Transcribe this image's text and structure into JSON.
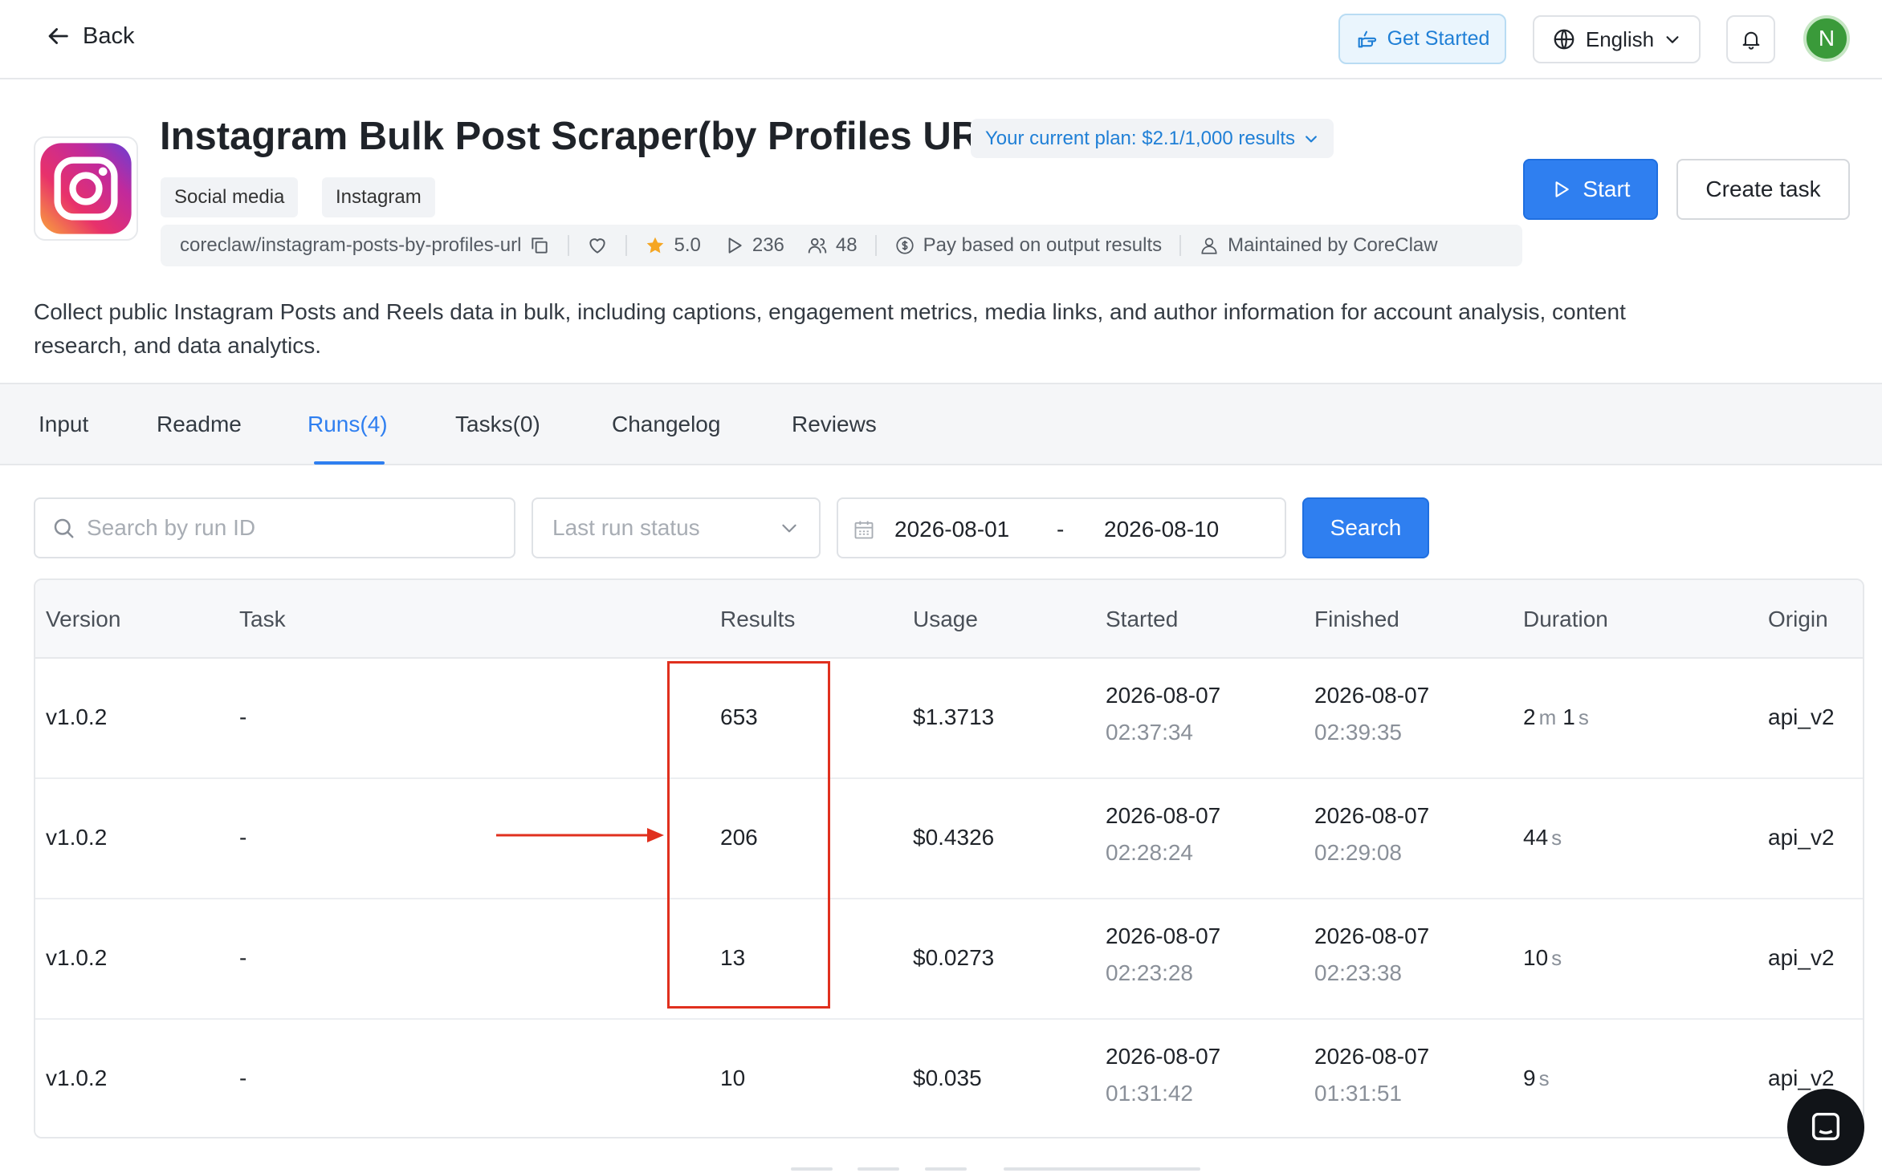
{
  "topbar": {
    "back_label": "Back",
    "get_started_label": "Get Started",
    "language_label": "English",
    "avatar_initial": "N"
  },
  "app": {
    "title": "Instagram Bulk Post Scraper(by Profiles URL)",
    "plan_label": "Your current plan: $2.1/1,000 results",
    "tags": [
      "Social media",
      "Instagram"
    ],
    "slug": "coreclaw/instagram-posts-by-profiles-url",
    "rating": "5.0",
    "runs_count": "236",
    "users_count": "48",
    "pricing": "Pay based on output results",
    "maintainer": "Maintained by CoreClaw",
    "start_label": "Start",
    "create_task_label": "Create task",
    "description": "Collect public Instagram Posts and Reels data in bulk, including captions, engagement metrics, media links, and author information for account analysis, content research, and data analytics."
  },
  "tabs": [
    "Input",
    "Readme",
    "Runs(4)",
    "Tasks(0)",
    "Changelog",
    "Reviews"
  ],
  "active_tab": "Runs(4)",
  "filters": {
    "search_placeholder": "Search by run ID",
    "status_placeholder": "Last run status",
    "date_from": "2026-08-01",
    "date_separator": "-",
    "date_to": "2026-08-10",
    "search_button": "Search"
  },
  "table": {
    "headers": [
      "Version",
      "Task",
      "Results",
      "Usage",
      "Started",
      "Finished",
      "Duration",
      "Origin"
    ],
    "rows": [
      {
        "version": "v1.0.2",
        "task": "-",
        "results": "653",
        "usage": "$1.3713",
        "started_date": "2026-08-07",
        "started_time": "02:37:34",
        "finished_date": "2026-08-07",
        "finished_time": "02:39:35",
        "duration_parts": [
          [
            "2",
            "m"
          ],
          [
            "1",
            "s"
          ]
        ],
        "origin": "api_v2"
      },
      {
        "version": "v1.0.2",
        "task": "-",
        "results": "206",
        "usage": "$0.4326",
        "started_date": "2026-08-07",
        "started_time": "02:28:24",
        "finished_date": "2026-08-07",
        "finished_time": "02:29:08",
        "duration_parts": [
          [
            "44",
            "s"
          ]
        ],
        "origin": "api_v2"
      },
      {
        "version": "v1.0.2",
        "task": "-",
        "results": "13",
        "usage": "$0.0273",
        "started_date": "2026-08-07",
        "started_time": "02:23:28",
        "finished_date": "2026-08-07",
        "finished_time": "02:23:38",
        "duration_parts": [
          [
            "10",
            "s"
          ]
        ],
        "origin": "api_v2"
      },
      {
        "version": "v1.0.2",
        "task": "-",
        "results": "10",
        "usage": "$0.035",
        "started_date": "2026-08-07",
        "started_time": "01:31:42",
        "finished_date": "2026-08-07",
        "finished_time": "01:31:51",
        "duration_parts": [
          [
            "9",
            "s"
          ]
        ],
        "origin": "api_v2"
      }
    ]
  },
  "colors": {
    "accent": "#2f7ff0",
    "annotation": "#e0301e"
  }
}
